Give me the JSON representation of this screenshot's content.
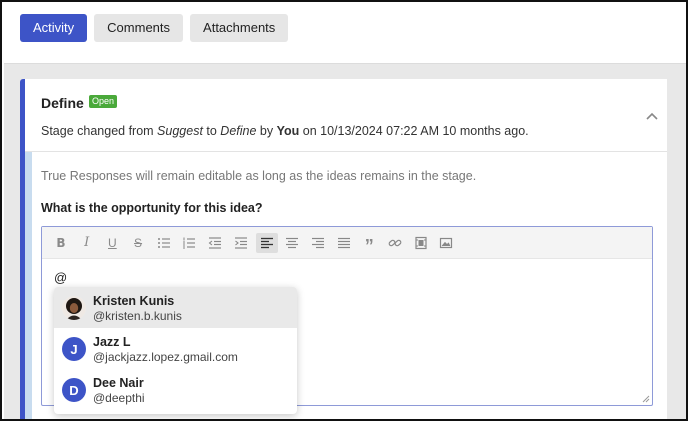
{
  "tabs": [
    {
      "label": "Activity",
      "active": true
    },
    {
      "label": "Comments",
      "active": false
    },
    {
      "label": "Attachments",
      "active": false
    }
  ],
  "stage": {
    "title": "Define",
    "badge": "Open",
    "info_prefix": "Stage changed from ",
    "from_stage": "Suggest",
    "to_word": " to ",
    "to_stage": "Define",
    "by_word": " by ",
    "user": "You",
    "timestamp": " on 10/13/2024 07:22 AM 10 months ago."
  },
  "body": {
    "help_text": "True Responses will remain editable as long as the ideas remains in the stage.",
    "question": "What is the opportunity for this idea?",
    "editor_value": "@"
  },
  "toolbar": [
    "bold-icon",
    "italic-icon",
    "underline-icon",
    "strikethrough-icon",
    "bullet-list-icon",
    "numbered-list-icon",
    "outdent-icon",
    "indent-icon",
    "align-left-icon",
    "align-center-icon",
    "align-right-icon",
    "justify-icon",
    "quote-icon",
    "link-icon",
    "video-icon",
    "image-icon"
  ],
  "mentions": [
    {
      "name": "Kristen Kunis",
      "handle": "@kristen.b.kunis",
      "avatar": "photo",
      "highlight": true
    },
    {
      "name": "Jazz L",
      "handle": "@jackjazz.lopez.gmail.com",
      "initial": "J",
      "highlight": false
    },
    {
      "name": "Dee Nair",
      "handle": "@deepthi",
      "initial": "D",
      "highlight": false
    }
  ],
  "colors": {
    "accent": "#3d54c7",
    "badge": "#4aa93a"
  }
}
